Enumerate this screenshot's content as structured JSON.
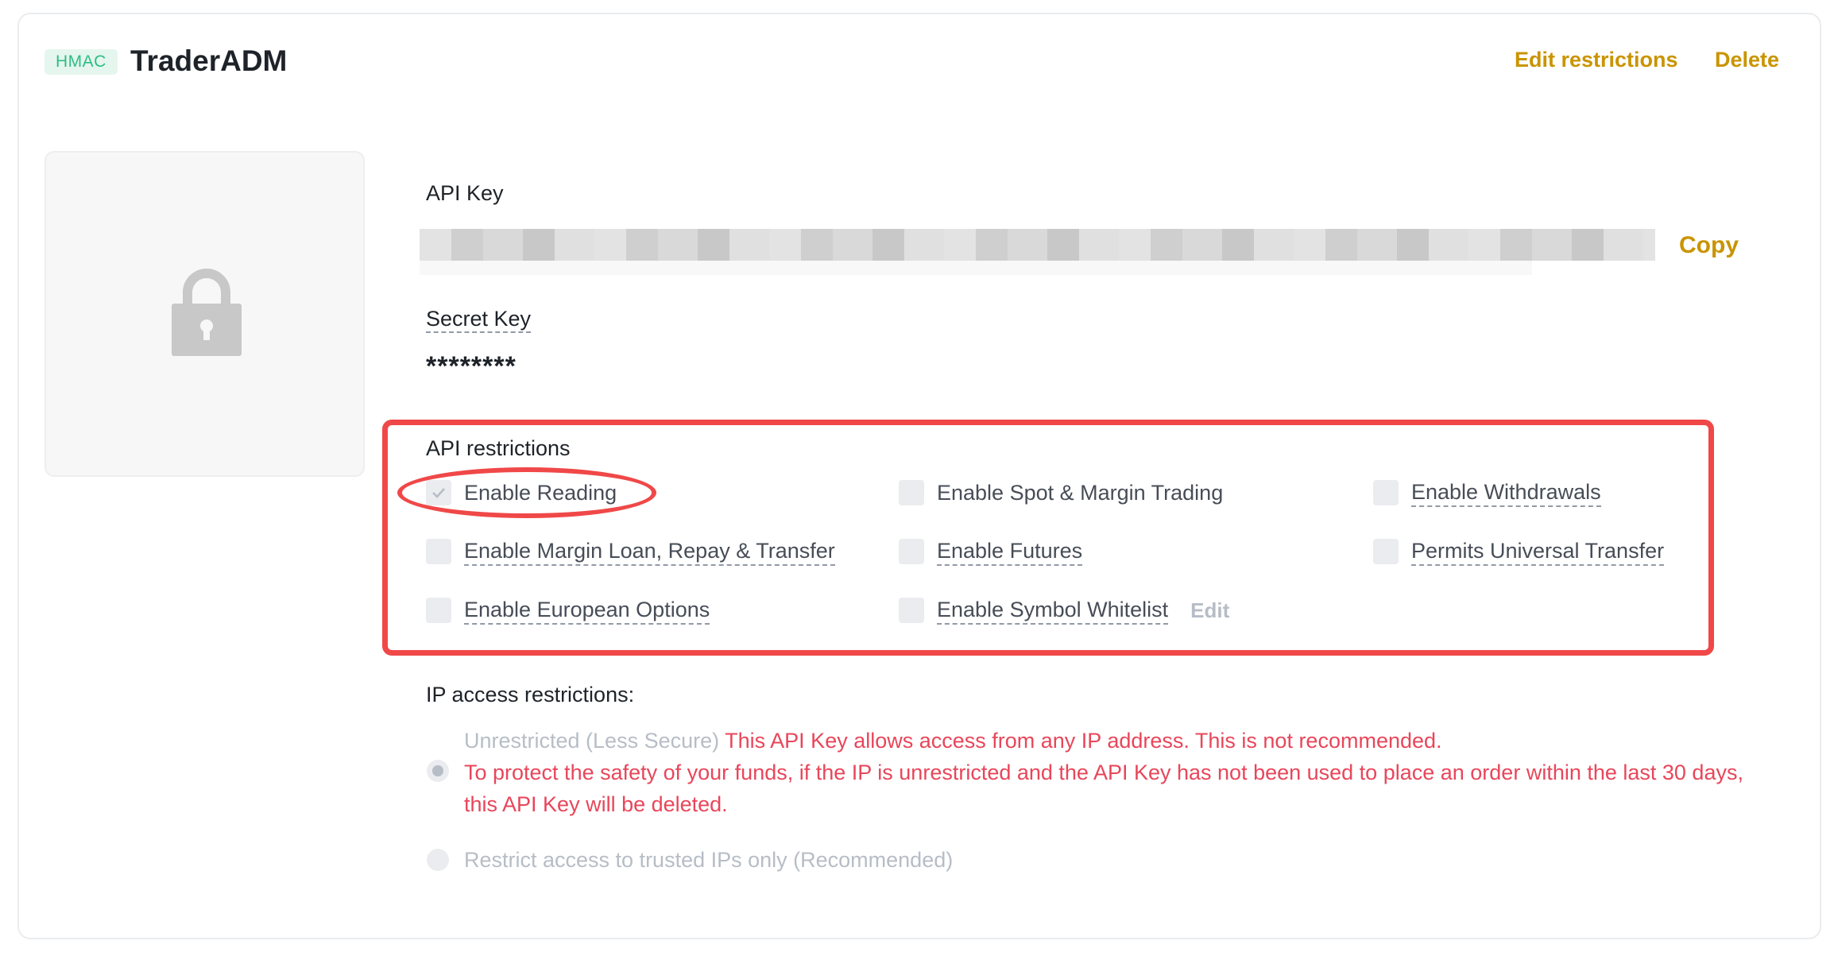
{
  "header": {
    "badge": "HMAC",
    "title": "TraderADM",
    "edit_restrictions_label": "Edit restrictions",
    "delete_label": "Delete"
  },
  "colors": {
    "accent": "#c99400",
    "badge_text": "#2ebd85",
    "badge_bg": "#e5f6ee",
    "warning": "#e8465a",
    "annotation": "#f04848"
  },
  "lock_icon": "lock-icon",
  "api_key": {
    "label": "API Key",
    "value_redacted": true,
    "copy_label": "Copy"
  },
  "secret_key": {
    "label": "Secret Key",
    "value": "********"
  },
  "api_restrictions": {
    "title": "API restrictions",
    "options": [
      {
        "label": "Enable Reading",
        "checked": true,
        "disabled": true
      },
      {
        "label": "Enable Spot & Margin Trading",
        "checked": false
      },
      {
        "label": "Enable Withdrawals",
        "checked": false
      },
      {
        "label": "Enable Margin Loan, Repay & Transfer",
        "checked": false
      },
      {
        "label": "Enable Futures",
        "checked": false
      },
      {
        "label": "Permits Universal Transfer",
        "checked": false
      },
      {
        "label": "Enable European Options",
        "checked": false
      },
      {
        "label": "Enable Symbol Whitelist",
        "checked": false
      }
    ],
    "whitelist_edit_label": "Edit"
  },
  "ip_restrictions": {
    "title": "IP access restrictions:",
    "unrestricted_label": "Unrestricted (Less Secure)",
    "unrestricted_warning": "This API Key allows access from any IP address. This is not recommended.",
    "deletion_warning": "To protect the safety of your funds, if the IP is unrestricted and the API Key has not been used to place an order within the last 30 days, this API Key will be deleted.",
    "restricted_label": "Restrict access to trusted IPs only (Recommended)",
    "selected": "unrestricted"
  }
}
